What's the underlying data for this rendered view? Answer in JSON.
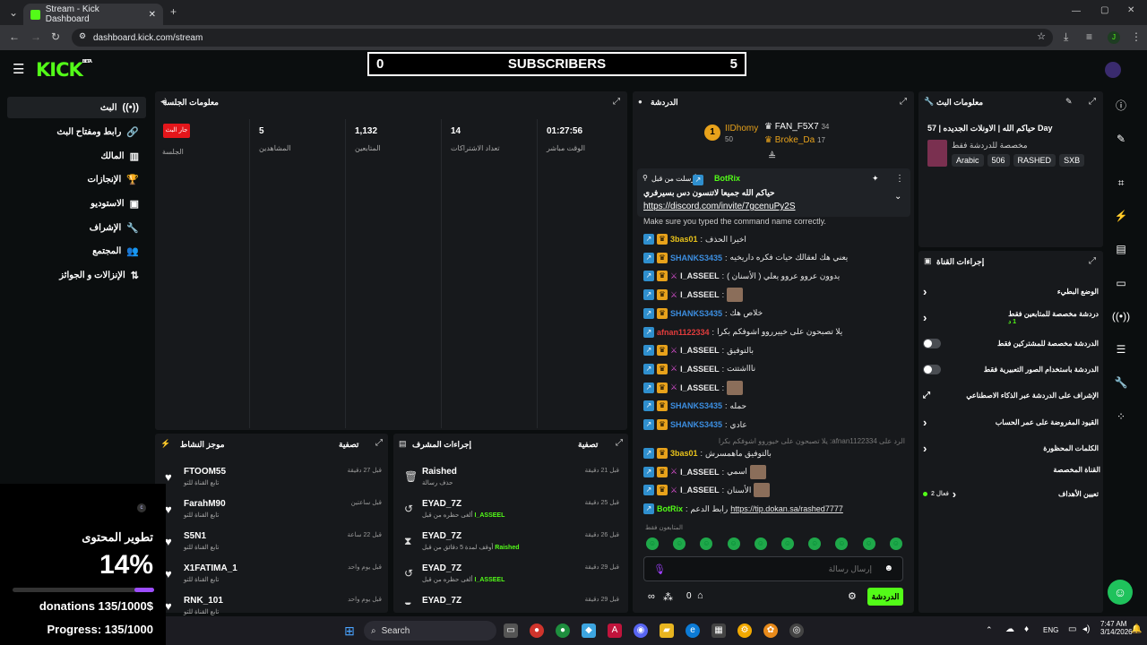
{
  "browser": {
    "tab_title": "Stream - Kick Dashboard",
    "url": "dashboard.kick.com/stream",
    "new_tab": "+",
    "profile_initial": "J"
  },
  "header": {
    "logo": "KICK",
    "logo_beta": "BETA",
    "subs_left": "0",
    "subs_title": "SUBSCRIBERS",
    "subs_right": "5"
  },
  "nav": {
    "items": [
      {
        "label": "البث",
        "icon": "((•))"
      },
      {
        "label": "رابط ومفتاح البث",
        "icon": "🔗"
      },
      {
        "label": "المالك",
        "icon": "▥"
      },
      {
        "label": "الإنجازات",
        "icon": "🏆"
      },
      {
        "label": "الاستوديو",
        "icon": "▣"
      },
      {
        "label": "الإشراف",
        "icon": "🔧"
      },
      {
        "label": "المجتمع",
        "icon": "👥"
      },
      {
        "label": "الإنزالات و الجوائز",
        "icon": "⇅"
      }
    ]
  },
  "session": {
    "title": "معلومات الجلسة",
    "live_badge": "جار البث",
    "session_label": "الجلسة",
    "stats": [
      {
        "value": "5",
        "label": "المشاهدين"
      },
      {
        "value": "1,132",
        "label": "المتابعين"
      },
      {
        "value": "14",
        "label": "تعداد الاشتراكات"
      },
      {
        "value": "01:27:56",
        "label": "الوقت مباشر"
      }
    ]
  },
  "activity": {
    "title": "موجز النشاط",
    "filter": "تصفية",
    "items": [
      {
        "name": "FTOOM55",
        "sub": "تابع القناة للتو",
        "time": "قبل 27 دقيقة"
      },
      {
        "name": "FarahM90",
        "sub": "تابع القناة للتو",
        "time": "قبل ساعتين"
      },
      {
        "name": "S5N1",
        "sub": "تابع القناة للتو",
        "time": "قبل 22 ساعة"
      },
      {
        "name": "X1FATIMA_1",
        "sub": "تابع القناة للتو",
        "time": "قبل يوم واحد"
      },
      {
        "name": "RNK_101",
        "sub": "تابع القناة للتو",
        "time": "قبل يوم واحد"
      }
    ]
  },
  "mod_actions": {
    "title": "إجراءات المشرف",
    "filter": "تصفية",
    "items": [
      {
        "icon": "🗑",
        "name": "Raished",
        "sub": "حذف رسالة",
        "target": "",
        "time": "قبل 21 دقيقة"
      },
      {
        "icon": "↺",
        "name": "EYAD_7Z",
        "sub": "ألغى حظره من قبل",
        "target": "I_ASSEEL",
        "time": "قبل 25 دقيقة"
      },
      {
        "icon": "⧗",
        "name": "EYAD_7Z",
        "sub": "أوقف لمدة 5 دقائق من قبل",
        "target": "Raished",
        "time": "قبل 26 دقيقة"
      },
      {
        "icon": "↺",
        "name": "EYAD_7Z",
        "sub": "ألغى حظره من قبل",
        "target": "I_ASSEEL",
        "time": "قبل 29 دقيقة"
      },
      {
        "icon": "⧗",
        "name": "EYAD_7Z",
        "sub": "",
        "target": "",
        "time": "قبل 29 دقيقة"
      }
    ]
  },
  "chat": {
    "title": "الدردشة",
    "leaderboard": [
      {
        "rank": "1",
        "name": "IIDhomy",
        "count": "50"
      },
      {
        "name": "FAN_F5X7",
        "count": "34"
      },
      {
        "name": "Broke_Da",
        "count": "17"
      }
    ],
    "pinned_by": "أرسلت من قبل",
    "pinned_user": "BotRix",
    "pinned_text": "حياكم الله جميعا لاتنسون دس بسيرفري",
    "pinned_link": "https://discord.com/invite/7gcenuPy2S",
    "system_msg": "Make sure you typed the command name correctly.",
    "messages": [
      {
        "user": "3bas01",
        "color": "#e8c21b",
        "text": "اخيرا الحذف",
        "badges": 2
      },
      {
        "user": "SHANKS3435",
        "color": "#3c8ee0",
        "text": "يعني هك لعقالك حيات فكره داريخيه",
        "badges": 2
      },
      {
        "user": "I_ASSEEL",
        "color": "#e8e8e8",
        "text": "يدوون عروو عروو يعلي ( الأسنان )",
        "badges": 3
      },
      {
        "user": "I_ASSEEL",
        "color": "#e8e8e8",
        "text": "",
        "badges": 3,
        "avatar": true
      },
      {
        "user": "SHANKS3435",
        "color": "#3c8ee0",
        "text": "خلاص هك",
        "badges": 2
      },
      {
        "user": "afnan1122334",
        "color": "#e03c3c",
        "text": "يلا تصبحون على خييرروو اشوفكم بكرا",
        "badges": 1
      },
      {
        "user": "I_ASSEEL",
        "color": "#e8e8e8",
        "text": "بالتوفيق",
        "badges": 3
      },
      {
        "user": "I_ASSEEL",
        "color": "#e8e8e8",
        "text": "ناااشتتت",
        "badges": 3
      },
      {
        "user": "I_ASSEEL",
        "color": "#e8e8e8",
        "text": "",
        "badges": 3,
        "avatar": true
      },
      {
        "user": "SHANKS3435",
        "color": "#3c8ee0",
        "text": "حمله",
        "badges": 2
      },
      {
        "user": "SHANKS3435",
        "color": "#3c8ee0",
        "text": "عادي",
        "badges": 2
      }
    ],
    "reply_line": "الرد على afnan1122334: يلا تصبحون على خيوروو اشوفكم بكرا",
    "messages2": [
      {
        "user": "3bas01",
        "color": "#e8c21b",
        "text": "بالتوفيق ماهمسرش",
        "badges": 2
      },
      {
        "user": "I_ASSEEL",
        "color": "#e8e8e8",
        "text": "اسمي",
        "badges": 3,
        "avatar": true
      },
      {
        "user": "I_ASSEEL",
        "color": "#e8e8e8",
        "text": "الأسنان",
        "badges": 3,
        "avatar": true
      },
      {
        "user": "BotRix",
        "color": "#53fc18",
        "text": "رابط الدعم",
        "link": "https://tip.dokan.sa/rashed7777",
        "badges": 1
      }
    ],
    "followers_only": "المتابعون فقط",
    "input_placeholder": "إرسال رسالة",
    "viewer_count": "0",
    "send_label": "الدردشة"
  },
  "stream_info": {
    "title": "معلومات البث",
    "stream_title": "حياكم الله | الاونلات الجديده | 57 Day",
    "category": "مخصصة للدردشة فقط",
    "tags": [
      "Arabic",
      "506",
      "RASHED",
      "SXB"
    ]
  },
  "channel_actions": {
    "title": "إجراءات القناة",
    "rows": [
      {
        "label": "الوضع البطيء",
        "control": "chev"
      },
      {
        "label": "دردشة مخصصة للمتابعين فقط",
        "sub": "1 د",
        "control": "chev"
      },
      {
        "label": "الدردشة مخصصة للمشتركين فقط",
        "control": "toggle"
      },
      {
        "label": "الدردشة باستخدام الصور التعبيرية فقط",
        "control": "toggle"
      },
      {
        "label": "الإشراف على الدردشة عبر الذكاء الاصطناعي",
        "control": "ext"
      },
      {
        "label": "القيود المفروضة على عمر الحساب",
        "control": "chev"
      },
      {
        "label": "الكلمات المحظورة",
        "control": "chev"
      }
    ],
    "custom_channel": "القناة المخصصة",
    "goals_label": "تعيين الأهداف",
    "goals_status": "فعال 2"
  },
  "overlay": {
    "title": "تطوير المحتوى",
    "percent": "14%",
    "progress": 0.14,
    "donations": "donations 135/1000$",
    "progress_text": "Progress: 135/1000"
  },
  "taskbar": {
    "search_label": "Search",
    "lang": "ENG",
    "time": "7:47 AM",
    "date": "3/14/2026"
  },
  "colors": {
    "brand": "#53fc18",
    "live_red": "#e4161b",
    "panel": "#17191c"
  }
}
